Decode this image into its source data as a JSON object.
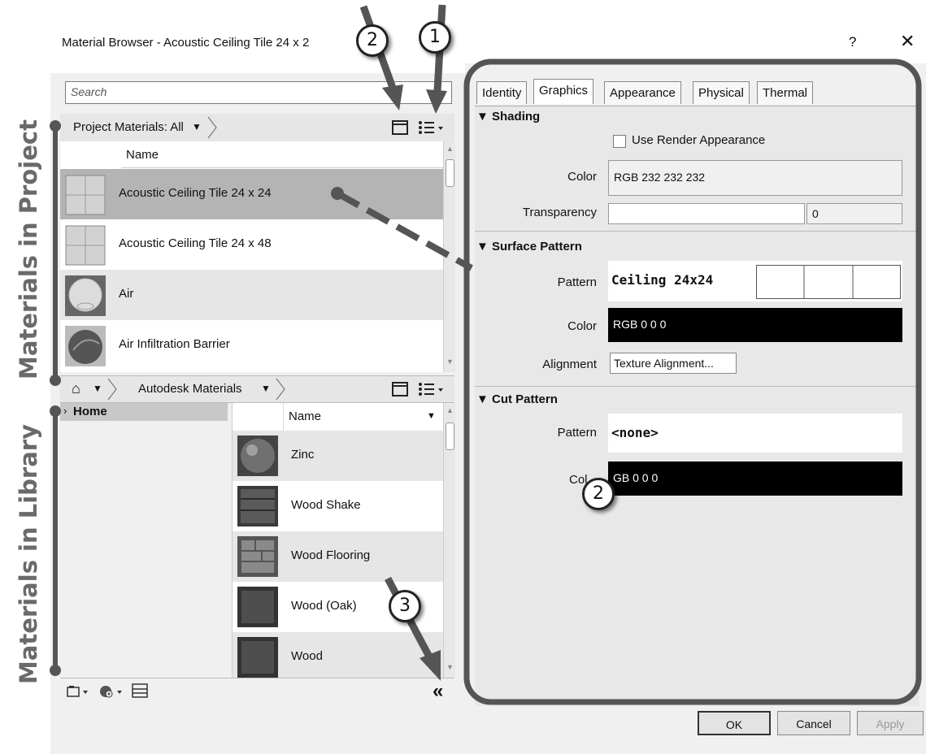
{
  "side_labels": {
    "project": "Materials in Project",
    "library": "Materials in Library"
  },
  "window": {
    "title": "Material Browser - Acoustic Ceiling Tile 24 x 2",
    "help": "?",
    "close": "✕"
  },
  "search": {
    "placeholder": "Search"
  },
  "project_bar": {
    "title": "Project Materials: All"
  },
  "project_table": {
    "column": "Name",
    "rows": [
      {
        "label": "Acoustic Ceiling Tile 24 x 24",
        "thumb": "grid-tile",
        "selected": true
      },
      {
        "label": "Acoustic Ceiling Tile 24 x 48",
        "thumb": "grid-tile",
        "selected": false
      },
      {
        "label": "Air",
        "thumb": "sphere-light",
        "selected": false
      },
      {
        "label": "Air Infiltration Barrier",
        "thumb": "sphere-dark",
        "selected": false
      }
    ]
  },
  "library_bar": {
    "title": "Autodesk Materials"
  },
  "tree": {
    "home": "Home"
  },
  "library_table": {
    "column": "Name",
    "rows": [
      {
        "label": "Zinc",
        "thumb": "sphere-metal"
      },
      {
        "label": "Wood Shake",
        "thumb": "wood-shake"
      },
      {
        "label": "Wood Flooring",
        "thumb": "wood-flooring"
      },
      {
        "label": "Wood (Oak)",
        "thumb": "wood-dark"
      },
      {
        "label": "Wood",
        "thumb": "wood-dark"
      }
    ]
  },
  "tabs": [
    "Identity",
    "Graphics",
    "Appearance",
    "Physical",
    "Thermal"
  ],
  "active_tab": "Graphics",
  "shading": {
    "header": "Shading",
    "use_render_label": "Use Render Appearance",
    "color_label": "Color",
    "color_value": "RGB 232 232 232",
    "transparency_label": "Transparency",
    "transparency_value": "0"
  },
  "surface_pattern": {
    "header": "Surface Pattern",
    "pattern_label": "Pattern",
    "pattern_value": "Ceiling 24x24",
    "color_label": "Color",
    "color_value": "RGB 0 0 0",
    "alignment_label": "Alignment",
    "alignment_button": "Texture Alignment..."
  },
  "cut_pattern": {
    "header": "Cut Pattern",
    "pattern_label": "Pattern",
    "pattern_value": "<none>",
    "color_label": "Col",
    "color_value": "GB 0 0 0"
  },
  "buttons": {
    "ok": "OK",
    "cancel": "Cancel",
    "apply": "Apply"
  },
  "callouts": [
    "2",
    "1",
    "2",
    "3"
  ],
  "colors": {
    "annotation": "#555555",
    "selected_row": "#b4b4b4",
    "alt_row": "#e6e6e6",
    "black_swatch": "#000000"
  }
}
